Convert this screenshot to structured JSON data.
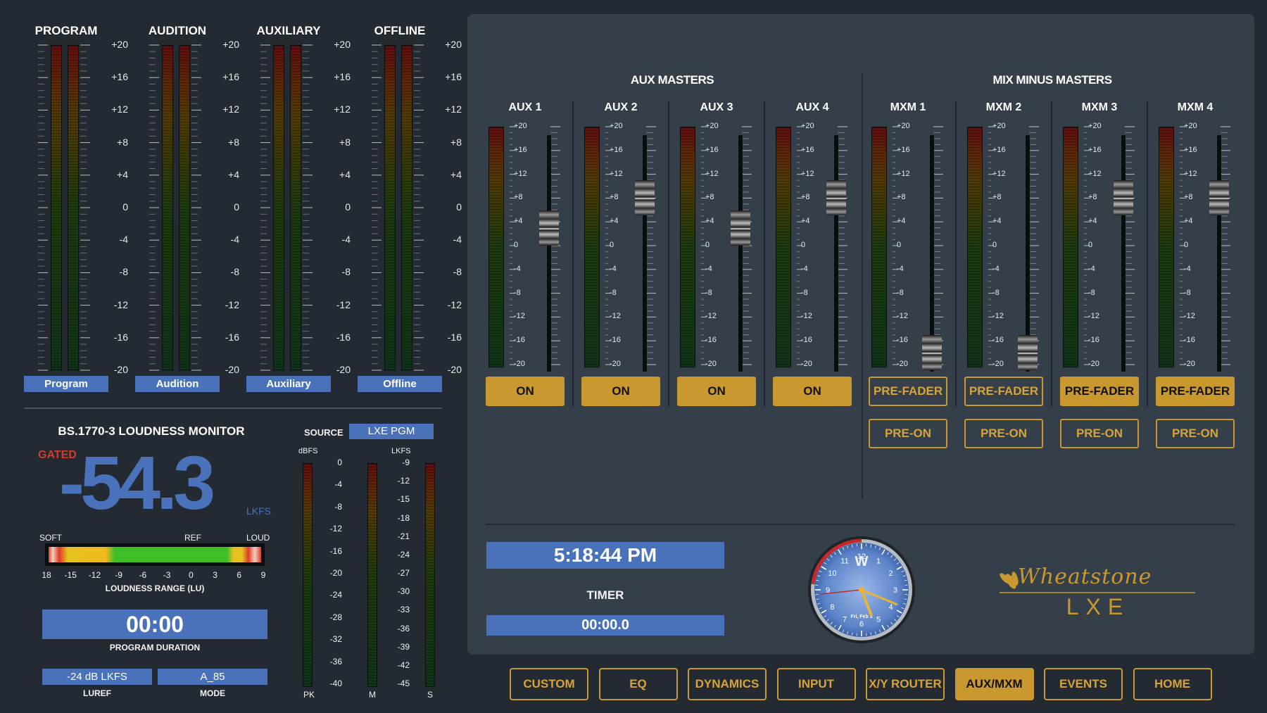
{
  "main_meters": {
    "scale": [
      "+20",
      "+16",
      "+12",
      "+8",
      "+4",
      "0",
      "-4",
      "-8",
      "-12",
      "-16",
      "-20"
    ],
    "items": [
      {
        "title": "PROGRAM",
        "button": "Program"
      },
      {
        "title": "AUDITION",
        "button": "Audition"
      },
      {
        "title": "AUXILIARY",
        "button": "Auxiliary"
      },
      {
        "title": "OFFLINE",
        "button": "Offline"
      }
    ]
  },
  "loudness": {
    "title": "BS.1770-3 LOUDNESS MONITOR",
    "gated": "GATED",
    "value": "-54.3",
    "unit": "LKFS",
    "range_soft": "SOFT",
    "range_ref": "REF",
    "range_loud": "LOUD",
    "range_ticks": [
      "18",
      "-15",
      "-12",
      "-9",
      "-6",
      "-3",
      "0",
      "3",
      "6",
      "9"
    ],
    "range_label": "LOUDNESS RANGE (LU)",
    "duration": "00:00",
    "duration_label": "PROGRAM DURATION",
    "luref": "-24 dB LKFS",
    "luref_label": "LUREF",
    "mode": "A_85",
    "mode_label": "MODE",
    "source_label": "SOURCE",
    "source": "LXE PGM",
    "dbfs_label": "dBFS",
    "lkfs_label": "LKFS",
    "dbfs_ticks": [
      "0",
      "-4",
      "-8",
      "-12",
      "-16",
      "-20",
      "-24",
      "-28",
      "-32",
      "-36",
      "-40"
    ],
    "lkfs_ticks": [
      "-9",
      "-12",
      "-15",
      "-18",
      "-21",
      "-24",
      "-27",
      "-30",
      "-33",
      "-36",
      "-39",
      "-42",
      "-45"
    ],
    "meter_labels": [
      "PK",
      "M",
      "S"
    ]
  },
  "aux_section": {
    "aux_title": "AUX MASTERS",
    "mxm_title": "MIX MINUS MASTERS",
    "scale": [
      "+20",
      "+16",
      "+12",
      "+8",
      "+4",
      "0",
      "-4",
      "-8",
      "-12",
      "-16",
      "-20"
    ],
    "aux": [
      {
        "label": "AUX 1",
        "button": "ON",
        "fader_level_db": 3
      },
      {
        "label": "AUX 2",
        "button": "ON",
        "fader_level_db": 8
      },
      {
        "label": "AUX 3",
        "button": "ON",
        "fader_level_db": 3
      },
      {
        "label": "AUX 4",
        "button": "ON",
        "fader_level_db": 8
      }
    ],
    "mxm": [
      {
        "label": "MXM 1",
        "button1": "PRE-FADER",
        "button1_active": false,
        "button2": "PRE-ON",
        "fader_level_db": -18
      },
      {
        "label": "MXM 2",
        "button1": "PRE-FADER",
        "button1_active": false,
        "button2": "PRE-ON",
        "fader_level_db": -18
      },
      {
        "label": "MXM 3",
        "button1": "PRE-FADER",
        "button1_active": true,
        "button2": "PRE-ON",
        "fader_level_db": 8
      },
      {
        "label": "MXM 4",
        "button1": "PRE-FADER",
        "button1_active": true,
        "button2": "PRE-ON",
        "fader_level_db": 8
      }
    ]
  },
  "clock": {
    "time": "5:18:44 PM",
    "timer_label": "TIMER",
    "timer": "00:00.0",
    "face_numbers": [
      "12",
      "1",
      "2",
      "3",
      "4",
      "5",
      "6",
      "7",
      "8",
      "9",
      "10",
      "11"
    ],
    "date": "Fri, Feb 3",
    "logo": "W"
  },
  "brand": {
    "name": "Wheatstone",
    "model": "LXE"
  },
  "nav": [
    {
      "label": "CUSTOM",
      "active": false
    },
    {
      "label": "EQ",
      "active": false
    },
    {
      "label": "DYNAMICS",
      "active": false
    },
    {
      "label": "INPUT",
      "active": false
    },
    {
      "label": "X/Y ROUTER",
      "active": false
    },
    {
      "label": "AUX/MXM",
      "active": true
    },
    {
      "label": "EVENTS",
      "active": false
    },
    {
      "label": "HOME",
      "active": false
    }
  ],
  "colors": {
    "background": "#232a31",
    "panel": "#353f4a",
    "gold": "#c9992f",
    "blue": "#4a72bb",
    "loudness_value": "#4a72bb",
    "gated": "#d83a2e"
  }
}
